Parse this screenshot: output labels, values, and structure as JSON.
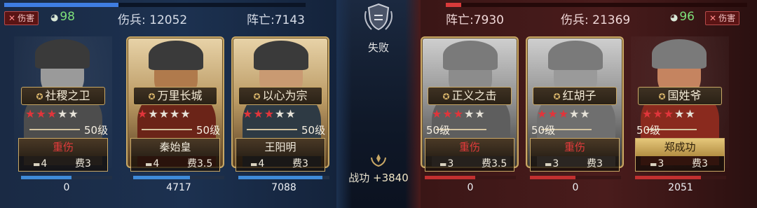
{
  "result": "失败",
  "merit": {
    "label": "战功",
    "value": "+3840"
  },
  "left_team": {
    "tag": "伤害",
    "morale": "98",
    "wounded": "伤兵: 12052",
    "dead": "阵亡:7143",
    "hp_fraction": 0.38,
    "heroes": [
      {
        "title": "社稷之卫",
        "stars": 3,
        "level": "50级",
        "status": "重伤",
        "troop": "4",
        "cost": "费3",
        "damage": "0",
        "damage_fraction": 0.55,
        "name": ""
      },
      {
        "title": "万里长城",
        "stars": 1,
        "level": "50级",
        "status": "秦始皇",
        "troop": "4",
        "cost": "费3.5",
        "damage": "4717",
        "damage_fraction": 0.62,
        "name": "秦始皇"
      },
      {
        "title": "以心为宗",
        "stars": 3,
        "level": "50级",
        "status": "王阳明",
        "troop": "4",
        "cost": "费3",
        "damage": "7088",
        "damage_fraction": 0.92,
        "name": "王阳明"
      }
    ]
  },
  "right_team": {
    "tag": "伤害",
    "morale": "96",
    "wounded": "伤兵: 21369",
    "dead": "阵亡:7930",
    "hp_fraction": 0.05,
    "heroes": [
      {
        "title": "正义之击",
        "stars": 3,
        "level": "50级",
        "status": "重伤",
        "troop": "3",
        "cost": "费3.5",
        "damage": "0",
        "damage_fraction": 0.55
      },
      {
        "title": "红胡子",
        "stars": 3,
        "level": "50级",
        "status": "重伤",
        "troop": "3",
        "cost": "费3",
        "damage": "0",
        "damage_fraction": 0.5
      },
      {
        "title": "国姓爷",
        "stars": 3,
        "level": "50级",
        "status": "郑成功",
        "troop": "3",
        "cost": "费3",
        "damage": "2051",
        "damage_fraction": 0.72
      }
    ]
  },
  "colors": {
    "ally": "#3f7de2",
    "enemy": "#d93a3a",
    "gold": "#c9a866",
    "injured": "#e23b3b"
  },
  "icons": {
    "tag": "crossed-swords-icon",
    "morale": "flexed-arm-icon",
    "title": "helmet-badge-icon",
    "troop": "tank-icon",
    "emblem": "shield-laurel-icon",
    "merit": "merit-laurel-icon"
  }
}
